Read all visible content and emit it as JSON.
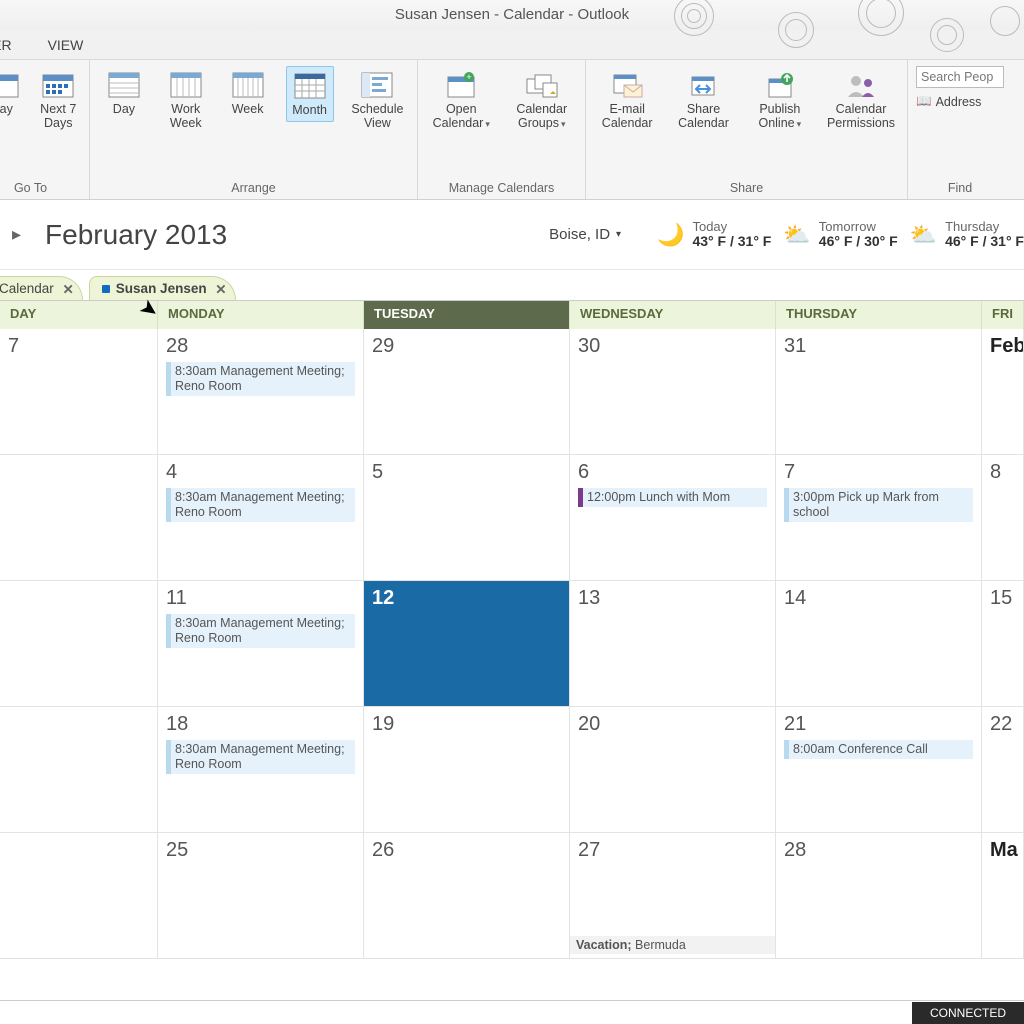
{
  "title": "Susan Jensen - Calendar - Outlook",
  "menubar": {
    "items": [
      "DER",
      "VIEW"
    ]
  },
  "ribbon": {
    "goto": {
      "label": "Go To",
      "today": "day",
      "next7": "Next 7\nDays"
    },
    "arrange": {
      "label": "Arrange",
      "day": "Day",
      "workweek": "Work\nWeek",
      "week": "Week",
      "month": "Month",
      "schedule": "Schedule\nView"
    },
    "manage": {
      "label": "Manage Calendars",
      "open": "Open\nCalendar",
      "groups": "Calendar\nGroups"
    },
    "share": {
      "label": "Share",
      "email": "E-mail\nCalendar",
      "share_cal": "Share\nCalendar",
      "publish": "Publish\nOnline",
      "perm": "Calendar\nPermissions"
    },
    "find": {
      "label": "Find",
      "placeholder": "Search Peop",
      "ab": "Address"
    }
  },
  "subhead": {
    "month": "February 2013",
    "location": "Boise, ID",
    "forecast": [
      {
        "day": "Today",
        "temp": "43° F / 31° F"
      },
      {
        "day": "Tomorrow",
        "temp": "46° F / 30° F"
      },
      {
        "day": "Thursday",
        "temp": "46° F / 31° F"
      }
    ]
  },
  "tabs": [
    {
      "label": "Calendar"
    },
    {
      "label": "Susan Jensen"
    }
  ],
  "day_headers": [
    "DAY",
    "MONDAY",
    "TUESDAY",
    "WEDNESDAY",
    "THURSDAY",
    "FRI"
  ],
  "grid": [
    [
      {
        "n": "7"
      },
      {
        "n": "28",
        "evt": "8:30am Management Meeting; Reno Room"
      },
      {
        "n": "29"
      },
      {
        "n": "30"
      },
      {
        "n": "31"
      },
      {
        "n": "Feb",
        "fri": true
      }
    ],
    [
      {
        "n": ""
      },
      {
        "n": "4",
        "evt": "8:30am Management Meeting; Reno Room"
      },
      {
        "n": "5"
      },
      {
        "n": "6",
        "evt": "12:00pm Lunch with Mom",
        "purple": true
      },
      {
        "n": "7",
        "evt": "3:00pm Pick up Mark from school"
      },
      {
        "n": "8"
      }
    ],
    [
      {
        "n": ""
      },
      {
        "n": "11",
        "evt": "8:30am Management Meeting; Reno Room"
      },
      {
        "n": "12",
        "sel": true
      },
      {
        "n": "13"
      },
      {
        "n": "14"
      },
      {
        "n": "15"
      }
    ],
    [
      {
        "n": ""
      },
      {
        "n": "18",
        "evt": "8:30am Management Meeting; Reno Room"
      },
      {
        "n": "19"
      },
      {
        "n": "20"
      },
      {
        "n": "21",
        "evt": "8:00am Conference Call"
      },
      {
        "n": "22"
      }
    ],
    [
      {
        "n": ""
      },
      {
        "n": "25"
      },
      {
        "n": "26"
      },
      {
        "n": "27",
        "allday_label": "Vacation;",
        "allday_text": " Bermuda"
      },
      {
        "n": "28"
      },
      {
        "n": "Ma",
        "fri": true
      }
    ]
  ],
  "status": "CONNECTED"
}
